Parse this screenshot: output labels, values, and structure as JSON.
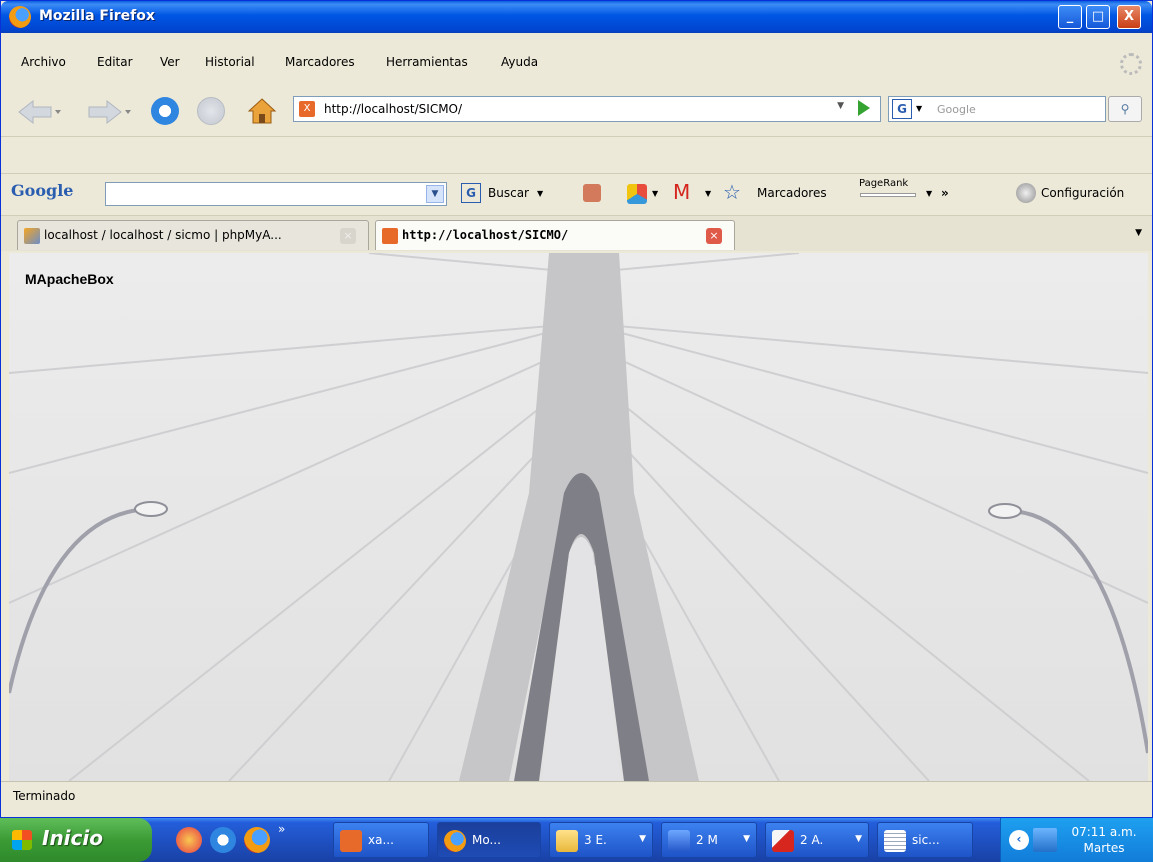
{
  "window": {
    "title": "Mozilla Firefox",
    "controls": {
      "minimize": "_",
      "maximize": "□",
      "close": "X"
    }
  },
  "menu": [
    "Archivo",
    "Editar",
    "Ver",
    "Historial",
    "Marcadores",
    "Herramientas",
    "Ayuda"
  ],
  "navigation": {
    "url": "http://localhost/SICMO/",
    "search_engine": "G",
    "search_placeholder": "Google",
    "favicon_letter": "X"
  },
  "google_toolbar": {
    "logo": "Google",
    "search_value": "",
    "items": {
      "buscar": "Buscar",
      "marcadores": "Marcadores",
      "pagerank": "PageRank",
      "more": "»",
      "configuracion": "Configuración"
    }
  },
  "tabs": [
    {
      "label": "localhost / localhost / sicmo | phpMyA...",
      "active": false
    },
    {
      "label": "http://localhost/SICMO/",
      "active": true
    }
  ],
  "page": {
    "heading": "MApacheBox"
  },
  "status": {
    "text": "Terminado"
  },
  "taskbar": {
    "start": "Inicio",
    "buttons": [
      {
        "label": "xa..."
      },
      {
        "label": "Mo..."
      },
      {
        "label": "3 E."
      },
      {
        "label": "2 M"
      },
      {
        "label": "2 A."
      },
      {
        "label": "sic..."
      }
    ],
    "overflow": "»",
    "clock": {
      "time": "07:11 a.m.",
      "day": "Martes"
    }
  },
  "colors": {
    "titlebar": "#0054e3",
    "start": "#3c9b35",
    "taskbar": "#245edb",
    "xampp_orange": "#e86a2b"
  }
}
